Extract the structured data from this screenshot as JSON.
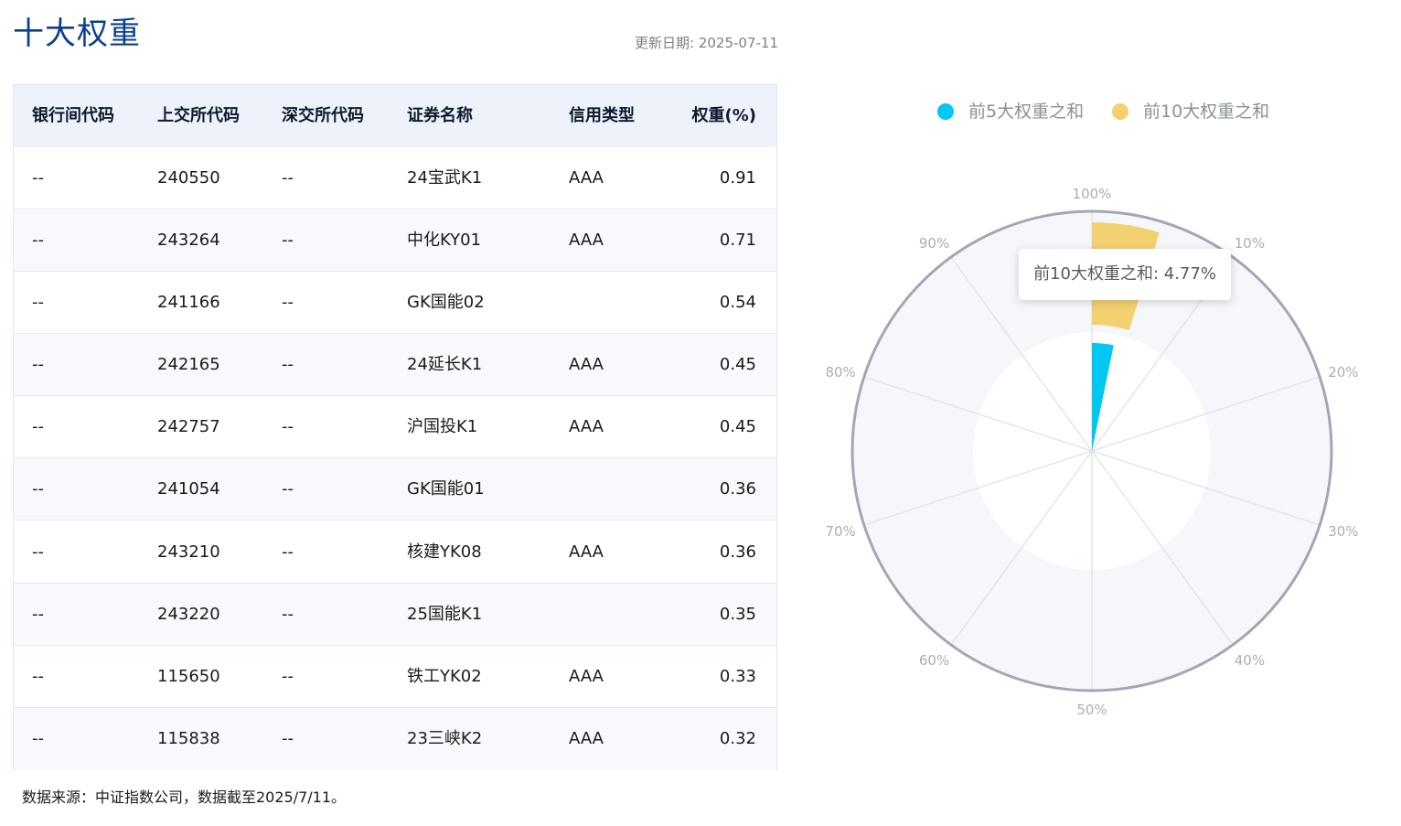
{
  "page": {
    "title": "十大权重",
    "update_date": "更新日期: 2025-07-11",
    "footer": "数据来源：中证指数公司，数据截至2025/7/11。"
  },
  "table": {
    "headers": [
      "银行间代码",
      "上交所代码",
      "深交所代码",
      "证券名称",
      "信用类型",
      "权重(%)"
    ],
    "rows": [
      [
        "--",
        "240550",
        "--",
        "24宝武K1",
        "AAA",
        "0.91"
      ],
      [
        "--",
        "243264",
        "--",
        "中化KY01",
        "AAA",
        "0.71"
      ],
      [
        "--",
        "241166",
        "--",
        "GK国能02",
        "",
        "0.54"
      ],
      [
        "--",
        "242165",
        "--",
        "24延长K1",
        "AAA",
        "0.45"
      ],
      [
        "--",
        "242757",
        "--",
        "沪国投K1",
        "AAA",
        "0.45"
      ],
      [
        "--",
        "241054",
        "--",
        "GK国能01",
        "",
        "0.36"
      ],
      [
        "--",
        "243210",
        "--",
        "核建YK08",
        "AAA",
        "0.36"
      ],
      [
        "--",
        "243220",
        "--",
        "25国能K1",
        "",
        "0.35"
      ],
      [
        "--",
        "115650",
        "--",
        "铁工YK02",
        "AAA",
        "0.33"
      ],
      [
        "--",
        "115838",
        "--",
        "23三峡K2",
        "AAA",
        "0.32"
      ]
    ]
  },
  "colors": {
    "title": "#0b3f8c",
    "top5": "#00c8f0",
    "top10": "#f3d170",
    "ring": "#a4a6b5",
    "background_band": "#f6f7fb"
  },
  "tooltip": {
    "text": "前10大权重之和: 4.77%"
  },
  "chart_data": {
    "type": "polar-bar",
    "angle_axis": {
      "min": 0,
      "max": 100,
      "unit": "%",
      "tick_labels": [
        "100%",
        "10%",
        "20%",
        "30%",
        "40%",
        "50%",
        "60%",
        "70%",
        "80%",
        "90%"
      ]
    },
    "series": [
      {
        "name": "前5大权重之和",
        "value": 3.23,
        "color": "#00c8f0"
      },
      {
        "name": "前10大权重之和",
        "value": 4.77,
        "color": "#f3d170"
      }
    ],
    "legend_position": "top"
  }
}
